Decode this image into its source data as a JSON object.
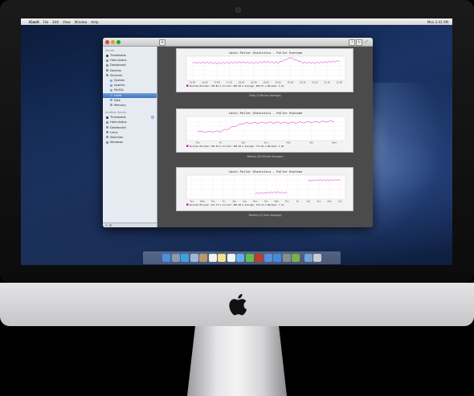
{
  "menubar": {
    "apple": "",
    "app_name": "iCacti",
    "menus": [
      "File",
      "Edit",
      "View",
      "Window",
      "Help"
    ],
    "clock": "Mon 2:41 AM"
  },
  "window": {
    "toolbar_icons": [
      "gear-icon",
      "share-icon",
      "refresh-icon",
      "fullscreen-icon"
    ]
  },
  "sidebar": {
    "section1_header": "Server",
    "section1_items": [
      {
        "label": "Thresholds",
        "icon": "warning-icon"
      },
      {
        "label": "Host status",
        "icon": "server-icon"
      },
      {
        "label": "Dashboard",
        "icon": "dashboard-icon"
      },
      {
        "label": "Devices",
        "icon": "device-icon"
      },
      {
        "label": "Services",
        "icon": "services-icon"
      },
      {
        "label": "System",
        "icon": "folder-icon"
      },
      {
        "label": "Apache",
        "icon": "folder-icon"
      },
      {
        "label": "MySQL",
        "icon": "folder-icon"
      },
      {
        "label": "Cacti",
        "icon": "folder-icon",
        "selected": true
      },
      {
        "label": "Disk",
        "icon": "folder-icon"
      },
      {
        "label": "Memory",
        "icon": "folder-icon"
      }
    ],
    "section2_header": "Another Server",
    "section2_items": [
      {
        "label": "Thresholds",
        "icon": "warning-icon",
        "badge": "2"
      },
      {
        "label": "Host status",
        "icon": "server-icon"
      },
      {
        "label": "Dashboard",
        "icon": "dashboard-icon"
      },
      {
        "label": "Linux",
        "icon": "device-icon"
      },
      {
        "label": "Switches",
        "icon": "device-icon"
      },
      {
        "label": "Windows",
        "icon": "device-icon"
      }
    ],
    "footer": "+  ⚙"
  },
  "graphs": [
    {
      "title": "Cacti Poller Statistics - Poller Runtime",
      "legend": "Runtime  Minimum:  758.80 m   Current:  885.00 m   Average:  800.07 m   Maximum:   2.44",
      "x_labels": [
        "16:00",
        "16:30",
        "17:00",
        "17:30",
        "18:00",
        "18:30",
        "19:00",
        "19:30",
        "20:00",
        "20:30",
        "21:00",
        "21:30",
        "22:00"
      ],
      "caption": "Daily (5 Minute Average)"
    },
    {
      "title": "Cacti Poller Statistics - Poller Runtime",
      "legend": "Runtime  Minimum:  384.20 m   Current:  886.20 m   Average:  771.64 m   Maximum:   1.48",
      "x_labels": [
        "Thu",
        "Fri",
        "Sat",
        "Sun",
        "Mon",
        "Tue",
        "Wed"
      ],
      "caption": "Weekly (30 Minute Average)"
    },
    {
      "title": "Cacti Poller Statistics - Poller Runtime",
      "legend": "Runtime  Minimum:  271.73 m   Current:  885.00 m   Average:  514.14 m   Maximum:   1.14",
      "x_labels": [
        "Tue",
        "Wed",
        "Thu",
        "Fri",
        "Sat",
        "Sun",
        "Mon",
        "Tue",
        "Wed",
        "Thu",
        "Fri",
        "Sat",
        "Sun",
        "Mon",
        "Tue"
      ],
      "caption": "Monthly (2 Hour Average)"
    }
  ],
  "chart_data": [
    {
      "type": "line",
      "title": "Cacti Poller Statistics - Poller Runtime",
      "x": [
        "16:00",
        "16:30",
        "17:00",
        "17:30",
        "18:00",
        "18:30",
        "19:00",
        "19:30",
        "20:00",
        "20:30",
        "21:00",
        "21:30",
        "22:00"
      ],
      "series": [
        {
          "name": "Runtime",
          "values": [
            0.8,
            0.82,
            0.79,
            0.81,
            0.83,
            0.8,
            0.85,
            0.81,
            1.6,
            0.82,
            0.8,
            0.84,
            0.89
          ]
        }
      ],
      "ylim": [
        0,
        1.0
      ]
    },
    {
      "type": "line",
      "title": "Cacti Poller Statistics - Poller Runtime",
      "x": [
        "Thu",
        "Fri",
        "Sat",
        "Sun",
        "Mon",
        "Tue",
        "Wed"
      ],
      "series": [
        {
          "name": "Runtime",
          "values": [
            0.4,
            0.42,
            0.8,
            0.83,
            0.82,
            0.85,
            0.89
          ]
        }
      ],
      "ylim": [
        0,
        1.0
      ]
    },
    {
      "type": "line",
      "title": "Cacti Poller Statistics - Poller Runtime",
      "x": [
        "Tue",
        "Wed",
        "Thu",
        "Fri",
        "Sat",
        "Sun",
        "Mon",
        "Tue",
        "Wed",
        "Thu",
        "Fri",
        "Sat",
        "Sun",
        "Mon",
        "Tue"
      ],
      "series": [
        {
          "name": "Runtime",
          "values": [
            null,
            null,
            null,
            null,
            null,
            null,
            0.27,
            0.3,
            0.32,
            0.3,
            null,
            0.85,
            0.88,
            0.87,
            0.89
          ]
        }
      ],
      "ylim": [
        0,
        1.0
      ]
    }
  ],
  "dock": {
    "icons": [
      {
        "name": "finder-icon",
        "color": "#4a8fe0"
      },
      {
        "name": "launchpad-icon",
        "color": "#8a9bb0"
      },
      {
        "name": "safari-icon",
        "color": "#3aa0e8"
      },
      {
        "name": "mail-icon",
        "color": "#9fb6d8"
      },
      {
        "name": "contacts-icon",
        "color": "#b89a6a"
      },
      {
        "name": "calendar-icon",
        "color": "#f2f2f2"
      },
      {
        "name": "notes-icon",
        "color": "#f3e38a"
      },
      {
        "name": "reminders-icon",
        "color": "#f4f4f4"
      },
      {
        "name": "messages-icon",
        "color": "#62b0ea"
      },
      {
        "name": "facetime-icon",
        "color": "#5fbf4a"
      },
      {
        "name": "photobooth-icon",
        "color": "#c23a2e"
      },
      {
        "name": "itunes-icon",
        "color": "#5a8fd6"
      },
      {
        "name": "appstore-icon",
        "color": "#3d8ee0"
      },
      {
        "name": "preferences-icon",
        "color": "#8c8c8c"
      },
      {
        "name": "icacti-icon",
        "color": "#7ab04a"
      },
      {
        "name": "folder-icon",
        "color": "#6ea3d8"
      },
      {
        "name": "trash-icon",
        "color": "#c8ccd2"
      }
    ]
  }
}
